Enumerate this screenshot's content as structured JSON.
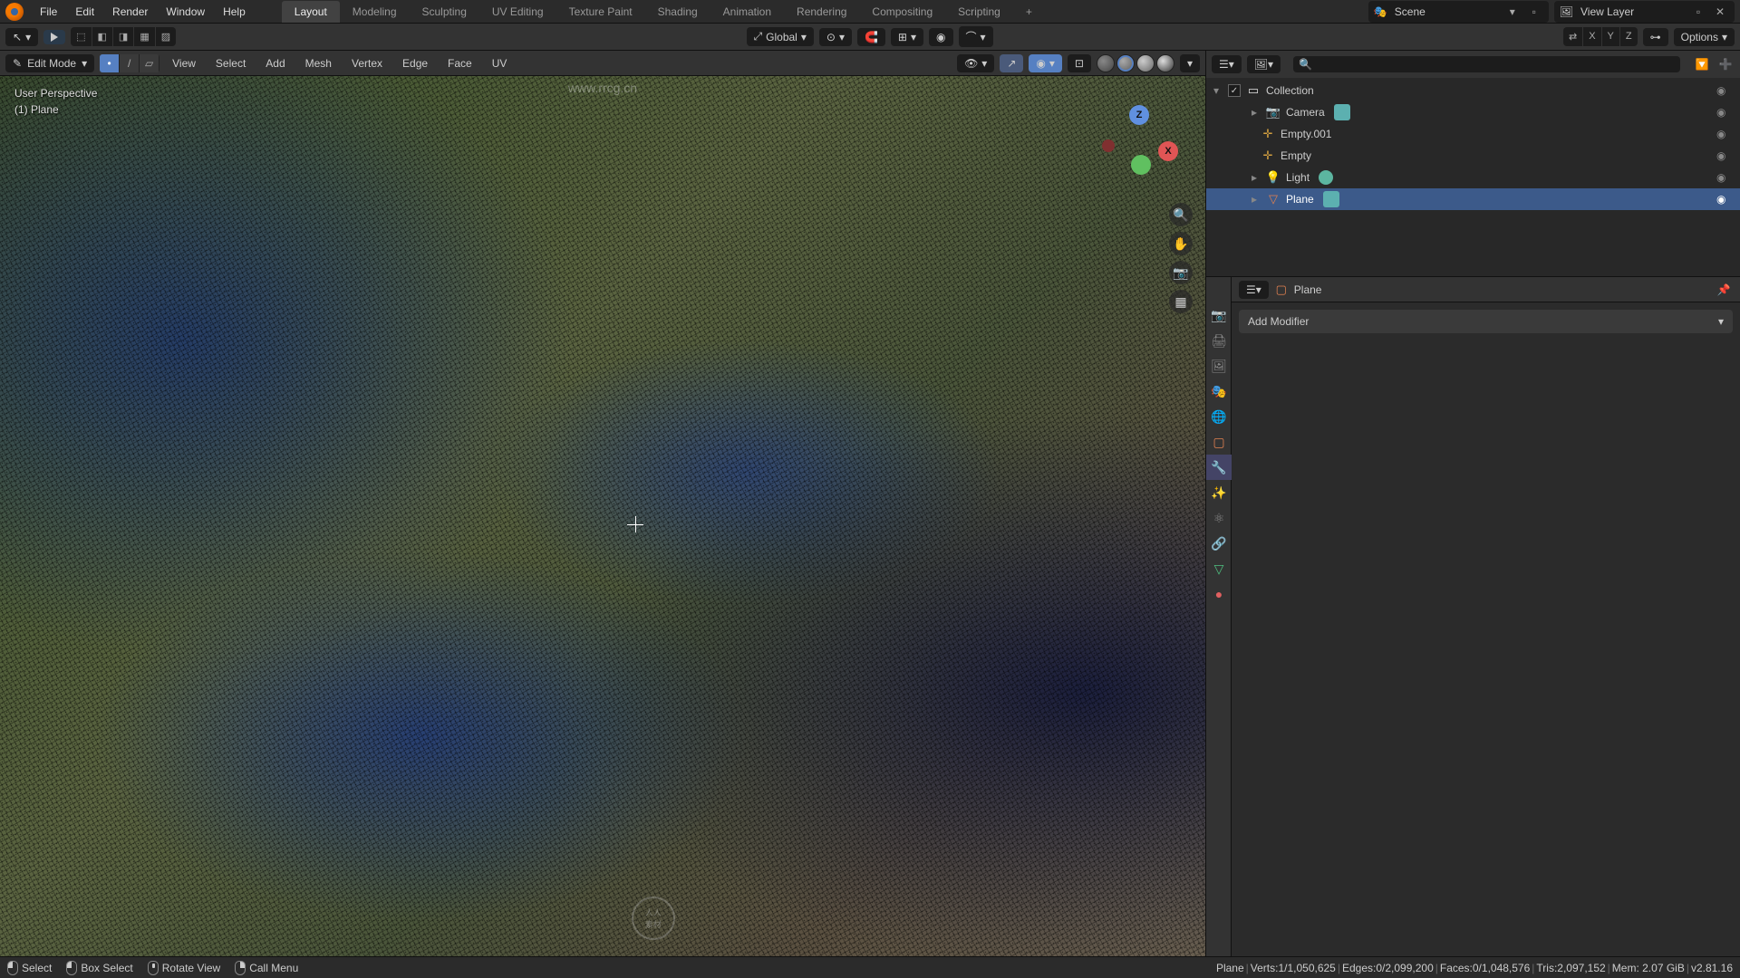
{
  "topmenu": {
    "file": "File",
    "edit": "Edit",
    "render": "Render",
    "window": "Window",
    "help": "Help"
  },
  "workspaces": {
    "tabs": [
      "Layout",
      "Modeling",
      "Sculpting",
      "UV Editing",
      "Texture Paint",
      "Shading",
      "Animation",
      "Rendering",
      "Compositing",
      "Scripting"
    ],
    "active": "Layout",
    "add": "+"
  },
  "scene": {
    "label": "Scene",
    "name": "Scene"
  },
  "viewlayer": {
    "label": "View Layer",
    "name": "View Layer"
  },
  "tool_header": {
    "orientation": "Global",
    "options": "Options",
    "axes": {
      "x": "X",
      "y": "Y",
      "z": "Z"
    }
  },
  "viewport": {
    "mode": "Edit Mode",
    "menus": {
      "view": "View",
      "select": "Select",
      "add": "Add",
      "mesh": "Mesh",
      "vertex": "Vertex",
      "edge": "Edge",
      "face": "Face",
      "uv": "UV"
    },
    "overlay": {
      "line1": "User Perspective",
      "line2": "(1) Plane"
    },
    "gizmo": {
      "z": "Z",
      "x": "X",
      "y": ""
    }
  },
  "outliner": {
    "search_placeholder": "",
    "root": "Collection",
    "items": [
      {
        "name": "Camera",
        "type": "camera",
        "indent": 36
      },
      {
        "name": "Empty.001",
        "type": "empty",
        "indent": 36
      },
      {
        "name": "Empty",
        "type": "empty",
        "indent": 36
      },
      {
        "name": "Light",
        "type": "light",
        "indent": 36
      },
      {
        "name": "Plane",
        "type": "plane",
        "indent": 36
      }
    ],
    "selected": "Plane"
  },
  "properties": {
    "context": "Plane",
    "context_icon": "Plane",
    "add_modifier": "Add Modifier"
  },
  "status": {
    "left": {
      "select": "Select",
      "box": "Box Select",
      "rotate": "Rotate View",
      "menu": "Call Menu"
    },
    "right": {
      "object": "Plane",
      "verts": "Verts:1/1,050,625",
      "edges": "Edges:0/2,099,200",
      "faces": "Faces:0/1,048,576",
      "tris": "Tris:2,097,152",
      "mem": "Mem: 2.07 GiB",
      "version": "v2.81.16"
    }
  },
  "watermark_url": "www.rrcg.cn"
}
